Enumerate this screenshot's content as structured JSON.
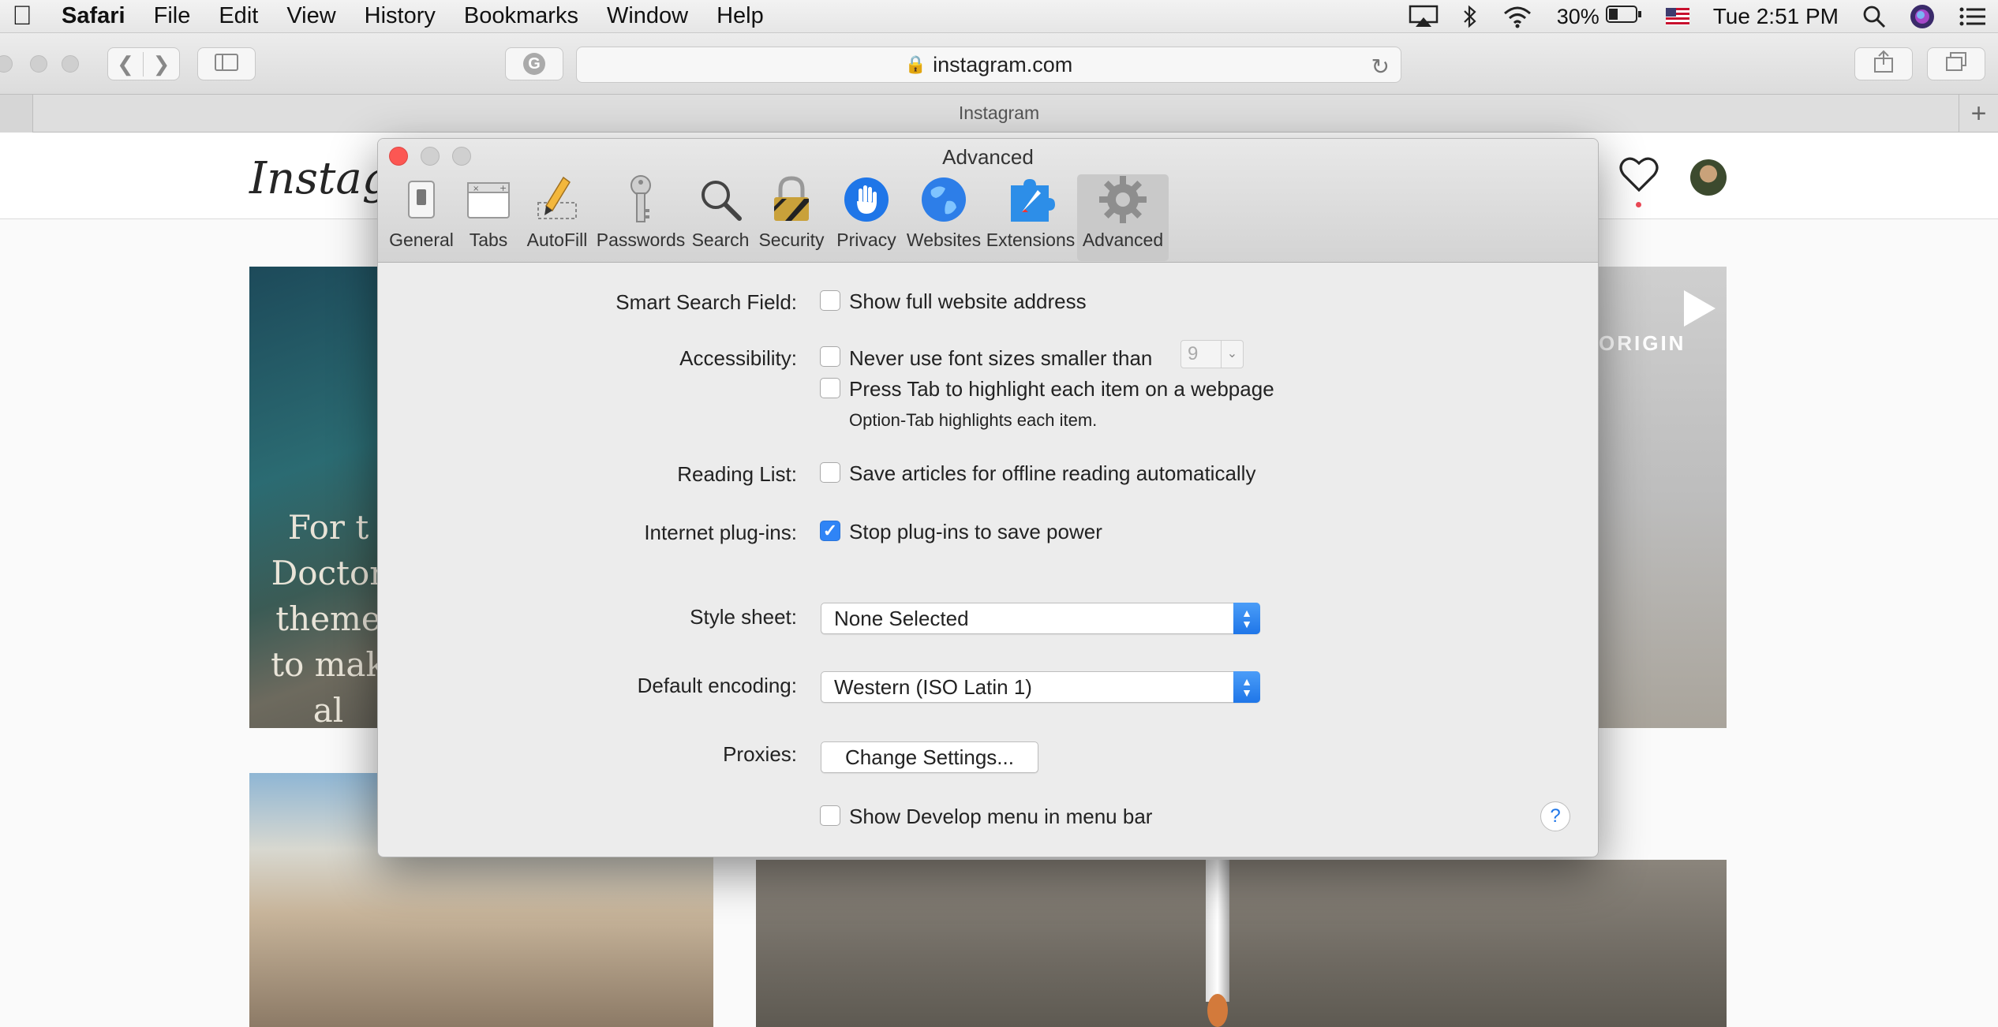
{
  "menubar": {
    "app": "Safari",
    "items": [
      "File",
      "Edit",
      "View",
      "History",
      "Bookmarks",
      "Window",
      "Help"
    ],
    "battery": "30%",
    "clock": "Tue 2:51 PM"
  },
  "browser": {
    "url": "instagram.com",
    "tab_title": "Instagram"
  },
  "instagram": {
    "logo": "Instagram",
    "post1_caption": [
      "For t",
      "Doctor",
      "theme",
      "to mak",
      "al"
    ],
    "post2_overlay": "ORIGIN"
  },
  "prefs": {
    "window_title": "Advanced",
    "tabs": [
      {
        "label": "General",
        "icon": "general-switch-icon"
      },
      {
        "label": "Tabs",
        "icon": "tabs-icon"
      },
      {
        "label": "AutoFill",
        "icon": "autofill-pencil-icon"
      },
      {
        "label": "Passwords",
        "icon": "key-icon"
      },
      {
        "label": "Search",
        "icon": "magnifier-icon"
      },
      {
        "label": "Security",
        "icon": "padlock-icon"
      },
      {
        "label": "Privacy",
        "icon": "hand-icon"
      },
      {
        "label": "Websites",
        "icon": "globe-icon"
      },
      {
        "label": "Extensions",
        "icon": "puzzle-icon"
      },
      {
        "label": "Advanced",
        "icon": "gear-icon"
      }
    ],
    "selected_tab": "Advanced",
    "smart_search": {
      "label": "Smart Search Field:",
      "option": "Show full website address",
      "checked": false
    },
    "accessibility": {
      "label": "Accessibility:",
      "font_option": "Never use font sizes smaller than",
      "font_size": "9",
      "tab_option": "Press Tab to highlight each item on a webpage",
      "tab_note": "Option-Tab highlights each item."
    },
    "reading_list": {
      "label": "Reading List:",
      "option": "Save articles for offline reading automatically",
      "checked": false
    },
    "plugins": {
      "label": "Internet plug-ins:",
      "option": "Stop plug-ins to save power",
      "checked": true
    },
    "style_sheet": {
      "label": "Style sheet:",
      "value": "None Selected"
    },
    "encoding": {
      "label": "Default encoding:",
      "value": "Western (ISO Latin 1)"
    },
    "proxies": {
      "label": "Proxies:",
      "button": "Change Settings..."
    },
    "develop": {
      "option": "Show Develop menu in menu bar",
      "checked": false
    },
    "help_label": "?"
  },
  "colors": {
    "accent": "#2f84f6",
    "close": "#fc5753",
    "notification_dot": "#ed4956"
  }
}
